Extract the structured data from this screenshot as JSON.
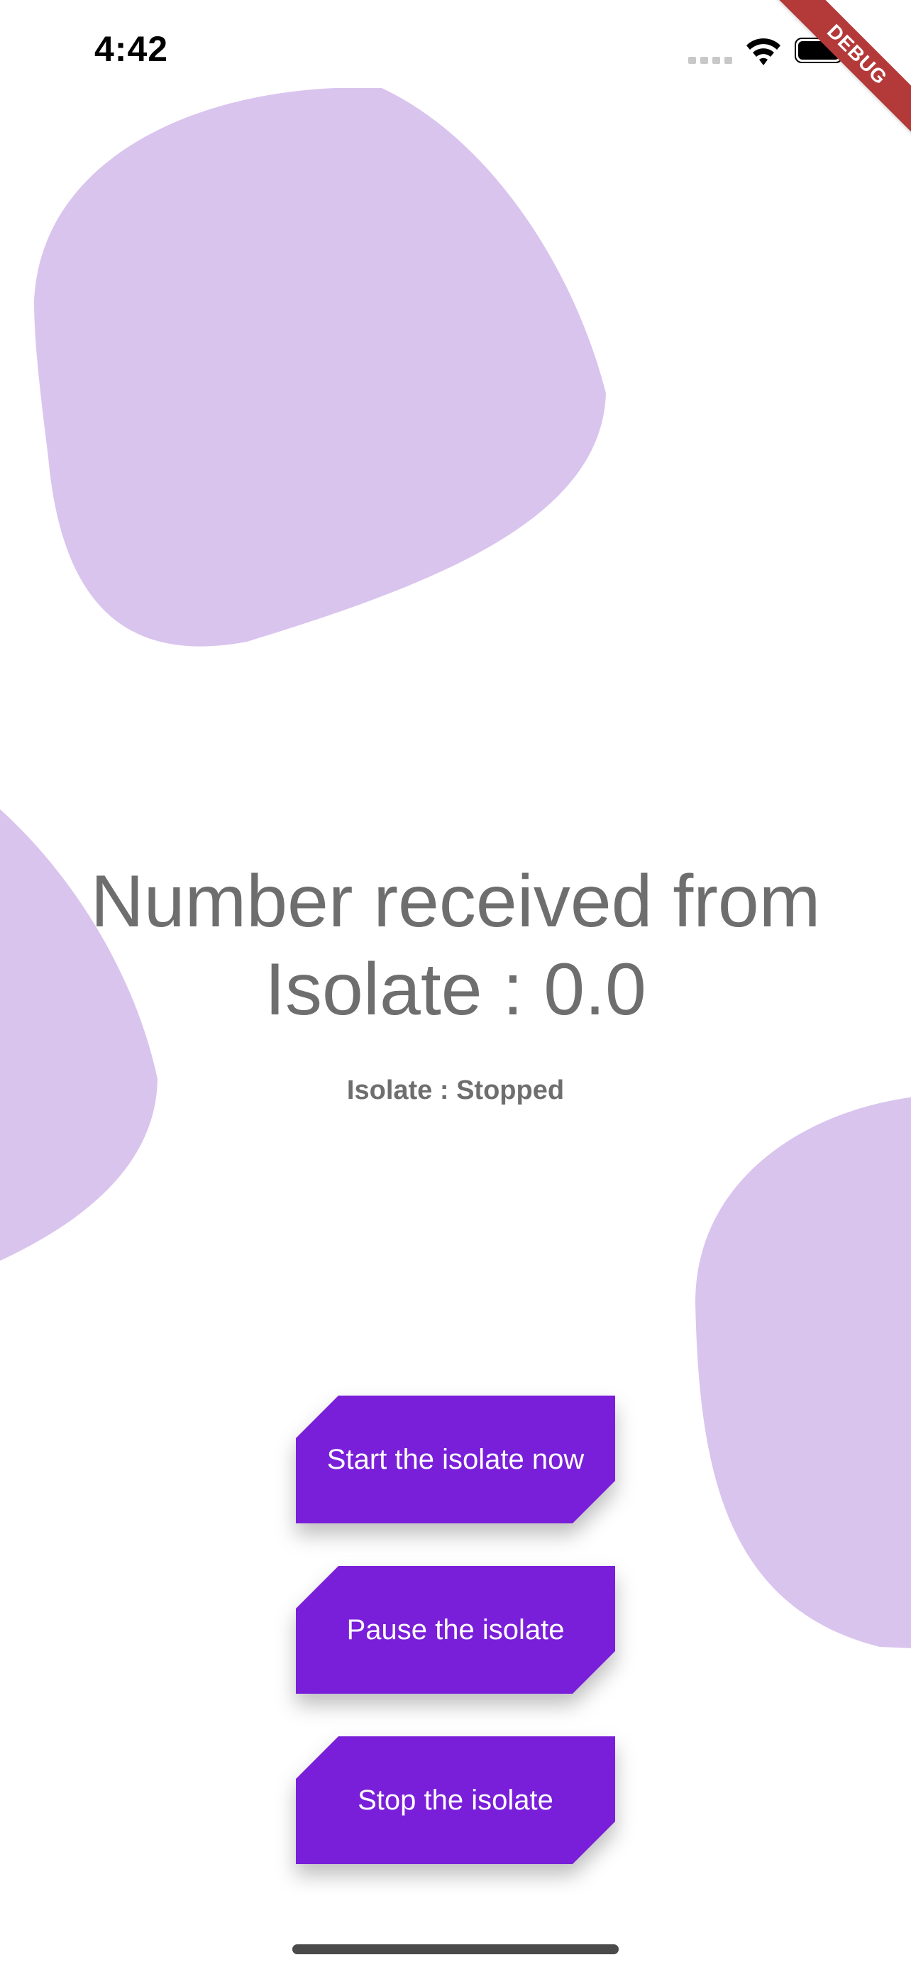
{
  "status_bar": {
    "time": "4:42",
    "signal_icon": "cellular-signal-icon",
    "wifi_icon": "wifi-icon",
    "battery_icon": "battery-icon"
  },
  "debug_banner": {
    "label": "DEBUG",
    "color": "#b43a3a"
  },
  "main": {
    "headline": "Number received from Isolate : 0.0",
    "status": "Isolate : Stopped"
  },
  "buttons": [
    {
      "label": "Start the isolate now"
    },
    {
      "label": "Pause the isolate"
    },
    {
      "label": "Stop the isolate"
    }
  ],
  "colors": {
    "accent": "#7a1fd9",
    "blob": "#d9c4ee",
    "text": "#6e6e6e"
  }
}
